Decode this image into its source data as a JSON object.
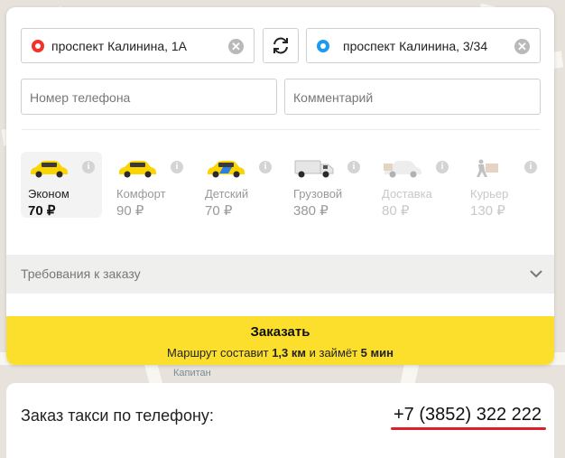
{
  "route": {
    "from": "проспект Калинина, 1А",
    "to": "проспект Калинина, 3/34",
    "clear_symbol": "✕"
  },
  "inputs": {
    "phone_placeholder": "Номер телефона",
    "comment_placeholder": "Комментарий"
  },
  "tariffs": [
    {
      "name": "Эконом",
      "price": "70 ₽",
      "state": "selected",
      "icon": "taxi-car-icon"
    },
    {
      "name": "Комфорт",
      "price": "90 ₽",
      "state": "available",
      "icon": "taxi-car-icon"
    },
    {
      "name": "Детский",
      "price": "70 ₽",
      "state": "available",
      "icon": "taxi-car-blue-stripe-icon"
    },
    {
      "name": "Грузовой",
      "price": "380 ₽",
      "state": "available",
      "icon": "cargo-van-icon"
    },
    {
      "name": "Доставка",
      "price": "80 ₽",
      "state": "disabled",
      "icon": "delivery-car-icon"
    },
    {
      "name": "Курьер",
      "price": "130 ₽",
      "state": "disabled",
      "icon": "courier-icon"
    }
  ],
  "info_symbol": "i",
  "requirements": {
    "label": "Требования к заказу"
  },
  "order": {
    "button_label": "Заказать",
    "route_prefix": "Маршрут составит ",
    "distance": "1,3 км",
    "route_middle": " и займёт ",
    "duration": "5 мин"
  },
  "map": {
    "street_label": "Капитан"
  },
  "phone_order": {
    "label": "Заказ такси по телефону:",
    "number": "+7 (3852) 322 222"
  },
  "colors": {
    "accent_yellow": "#fcdf2c",
    "from_marker": "#f2322b",
    "to_marker": "#1a9cf0",
    "underline": "#e01e2a"
  }
}
